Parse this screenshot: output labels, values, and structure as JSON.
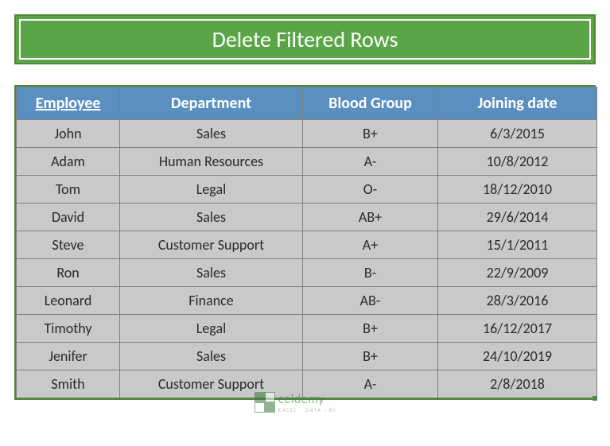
{
  "title": "Delete Filtered Rows",
  "columns": [
    "Employee",
    "Department",
    "Blood Group",
    "Joining date"
  ],
  "active_column_index": 0,
  "rows": [
    {
      "employee": "John",
      "department": "Sales",
      "blood": "B+",
      "joining": "6/3/2015"
    },
    {
      "employee": "Adam",
      "department": "Human Resources",
      "blood": "A-",
      "joining": "10/8/2012"
    },
    {
      "employee": "Tom",
      "department": "Legal",
      "blood": "O-",
      "joining": "18/12/2010"
    },
    {
      "employee": "David",
      "department": "Sales",
      "blood": "AB+",
      "joining": "29/6/2014"
    },
    {
      "employee": "Steve",
      "department": "Customer Support",
      "blood": "A+",
      "joining": "15/1/2011"
    },
    {
      "employee": "Ron",
      "department": "Sales",
      "blood": "B-",
      "joining": "22/9/2009"
    },
    {
      "employee": "Leonard",
      "department": "Finance",
      "blood": "AB-",
      "joining": "28/3/2016"
    },
    {
      "employee": "Timothy",
      "department": "Legal",
      "blood": "B+",
      "joining": "16/12/2017"
    },
    {
      "employee": "Jenifer",
      "department": "Sales",
      "blood": "B+",
      "joining": "24/10/2019"
    },
    {
      "employee": "Smith",
      "department": "Customer Support",
      "blood": "A-",
      "joining": "2/8/2018"
    }
  ],
  "watermark": {
    "brand": "celdemy",
    "tagline": "EXCEL · DATA · BI"
  },
  "chart_data": {
    "type": "table",
    "title": "Delete Filtered Rows",
    "columns": [
      "Employee",
      "Department",
      "Blood Group",
      "Joining date"
    ],
    "rows": [
      [
        "John",
        "Sales",
        "B+",
        "6/3/2015"
      ],
      [
        "Adam",
        "Human Resources",
        "A-",
        "10/8/2012"
      ],
      [
        "Tom",
        "Legal",
        "O-",
        "18/12/2010"
      ],
      [
        "David",
        "Sales",
        "AB+",
        "29/6/2014"
      ],
      [
        "Steve",
        "Customer Support",
        "A+",
        "15/1/2011"
      ],
      [
        "Ron",
        "Sales",
        "B-",
        "22/9/2009"
      ],
      [
        "Leonard",
        "Finance",
        "AB-",
        "28/3/2016"
      ],
      [
        "Timothy",
        "Legal",
        "B+",
        "16/12/2017"
      ],
      [
        "Jenifer",
        "Sales",
        "B+",
        "24/10/2019"
      ],
      [
        "Smith",
        "Customer Support",
        "A-",
        "2/8/2018"
      ]
    ]
  }
}
